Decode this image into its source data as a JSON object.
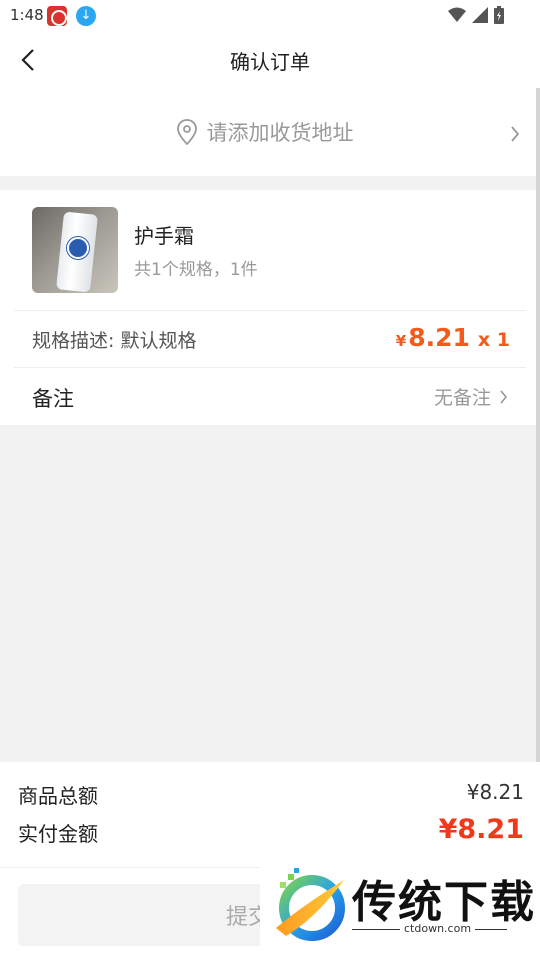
{
  "status_bar": {
    "time": "1:48"
  },
  "header": {
    "title": "确认订单"
  },
  "address": {
    "placeholder": "请添加收货地址"
  },
  "product": {
    "name": "护手霜",
    "summary": "共1个规格，1件",
    "spec_label": "规格描述: 默认规格",
    "price_symbol": "¥",
    "price": "8.21",
    "quantity": "x 1"
  },
  "remark": {
    "label": "备注",
    "value": "无备注"
  },
  "summary": {
    "goods_total_label": "商品总额",
    "goods_total_value": "¥8.21",
    "paid_label": "实付金额",
    "paid_value": "¥8.21"
  },
  "footer": {
    "submit_label": "提交订单"
  },
  "watermark": {
    "brand": "传统下载",
    "url": "ctdown.com"
  },
  "colors": {
    "accent": "#f45a1c",
    "paid": "#f0381a",
    "placeholder": "#999999",
    "background": "#f2f2f2"
  }
}
